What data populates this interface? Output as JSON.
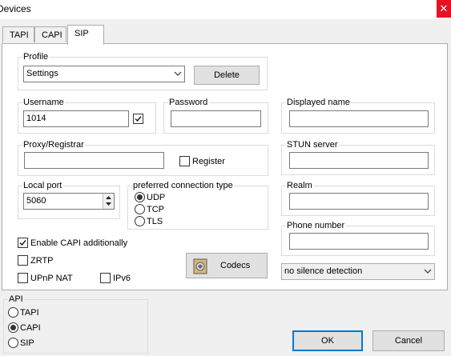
{
  "window": {
    "title": "Devices",
    "close_glyph": "✕"
  },
  "tabs": [
    {
      "label": "TAPI"
    },
    {
      "label": "CAPI"
    },
    {
      "label": "SIP"
    }
  ],
  "profile": {
    "label": "Profile",
    "selected": "Settings",
    "delete_label": "Delete"
  },
  "username": {
    "label": "Username",
    "value": "1014",
    "checked": true
  },
  "password": {
    "label": "Password",
    "value": ""
  },
  "displayed_name": {
    "label": "Displayed name",
    "value": ""
  },
  "proxy": {
    "label": "Proxy/Registrar",
    "value": "",
    "register_label": "Register",
    "register_checked": false
  },
  "stun": {
    "label": "STUN server",
    "value": ""
  },
  "local_port": {
    "label": "Local port",
    "value": "5060"
  },
  "conn_type": {
    "label": "preferred connection type",
    "options": [
      "UDP",
      "TCP",
      "TLS"
    ],
    "selected": "UDP"
  },
  "realm": {
    "label": "Realm",
    "value": ""
  },
  "phone_number": {
    "label": "Phone number",
    "value": ""
  },
  "options": {
    "enable_capi": {
      "label": "Enable CAPI additionally",
      "checked": true
    },
    "zrtp": {
      "label": "ZRTP",
      "checked": false
    },
    "upnp": {
      "label": "UPnP NAT",
      "checked": false
    },
    "ipv6": {
      "label": "IPv6",
      "checked": false
    }
  },
  "codecs_label": "Codecs",
  "silence": {
    "selected": "no silence detection"
  },
  "api": {
    "label": "API",
    "options": [
      "TAPI",
      "CAPI",
      "SIP"
    ],
    "selected": "CAPI"
  },
  "buttons": {
    "ok": "OK",
    "cancel": "Cancel"
  },
  "colors": {
    "accent": "#0078d7",
    "close": "#e81123"
  }
}
